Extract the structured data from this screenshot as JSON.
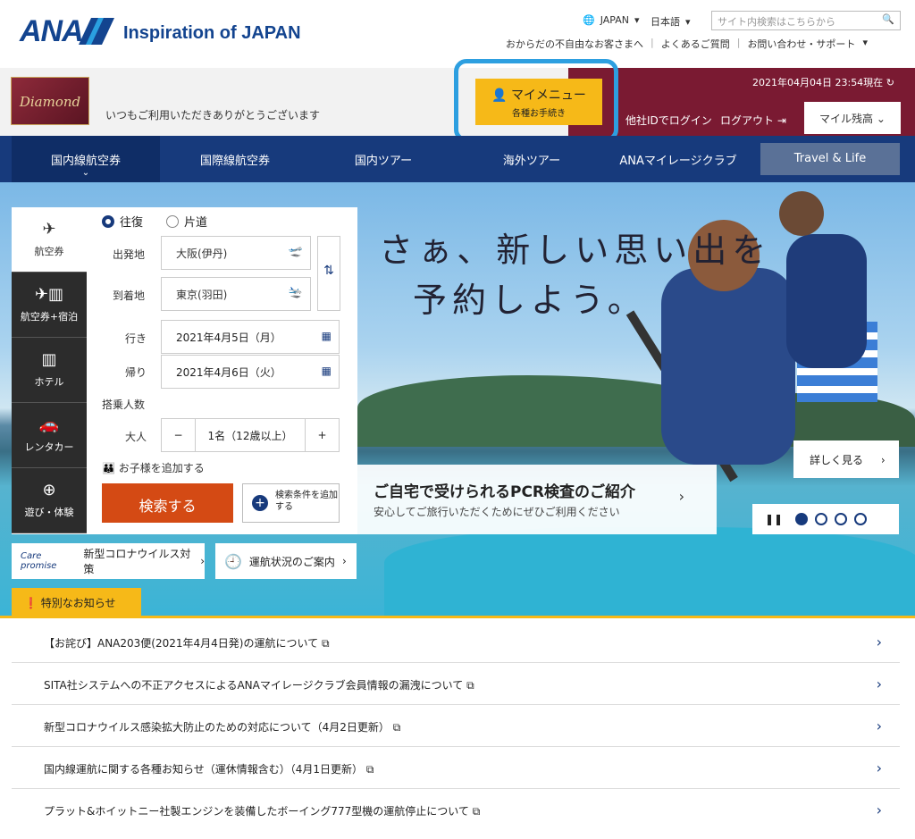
{
  "header": {
    "brand": "ANA",
    "tagline": "Inspiration of JAPAN",
    "region": "JAPAN",
    "language": "日本語",
    "search_placeholder": "サイト内検索はこちらから",
    "links": [
      "おからだの不自由なお客さまへ",
      "よくあるご質問",
      "お問い合わせ・サポート"
    ]
  },
  "member": {
    "status_logo": "Diamond",
    "welcome": "いつもご利用いただきありがとうございます",
    "mymenu_title": "マイメニュー",
    "mymenu_sub": "各種お手続き",
    "datetime": "2021年04月04日 23:54現在",
    "login_other": "他社IDでログイン",
    "logout": "ログアウト",
    "miles": "マイル残高"
  },
  "nav": [
    "国内線航空券",
    "国際線航空券",
    "国内ツアー",
    "海外ツアー",
    "ANAマイレージクラブ",
    "Travel & Life"
  ],
  "search": {
    "tabs": [
      "航空券",
      "航空券+宿泊",
      "ホテル",
      "レンタカー",
      "遊び・体験"
    ],
    "trip_round": "往復",
    "trip_oneway": "片道",
    "from_label": "出発地",
    "from_value": "大阪(伊丹)",
    "to_label": "到着地",
    "to_value": "東京(羽田)",
    "depart_label": "行き",
    "depart_value": "2021年4月5日（月）",
    "return_label": "帰り",
    "return_value": "2021年4月6日（火）",
    "pax_label": "搭乗人数",
    "adult_label": "大人",
    "adult_value": "1名（12歳以上）",
    "add_child": "お子様を追加する",
    "search_btn": "検索する",
    "cond_btn": "検索条件を追加する"
  },
  "hero": {
    "catch_line1": "さぁ、新しい思い出を",
    "catch_line2": "予約しよう。",
    "detail": "詳しく見る",
    "pcr_title": "ご自宅で受けられるPCR検査のご紹介",
    "pcr_sub": "安心してご旅行いただくためにぜひご利用ください",
    "covid": "新型コロナウイルス対策",
    "care": "Care promise",
    "flight_status": "運航状況のご案内",
    "notice_tag": "特別なお知らせ"
  },
  "news": [
    "【お詫び】ANA203便(2021年4月4日発)の運航について",
    "SITA社システムへの不正アクセスによるANAマイレージクラブ会員情報の漏洩について",
    "新型コロナウイルス感染拡大防止のための対応について（4月2日更新）",
    "国内線運航に関する各種お知らせ（運休情報含む）（4月1日更新）",
    "プラット&ホイットニー社製エンジンを装備したボーイング777型機の運航停止について"
  ]
}
